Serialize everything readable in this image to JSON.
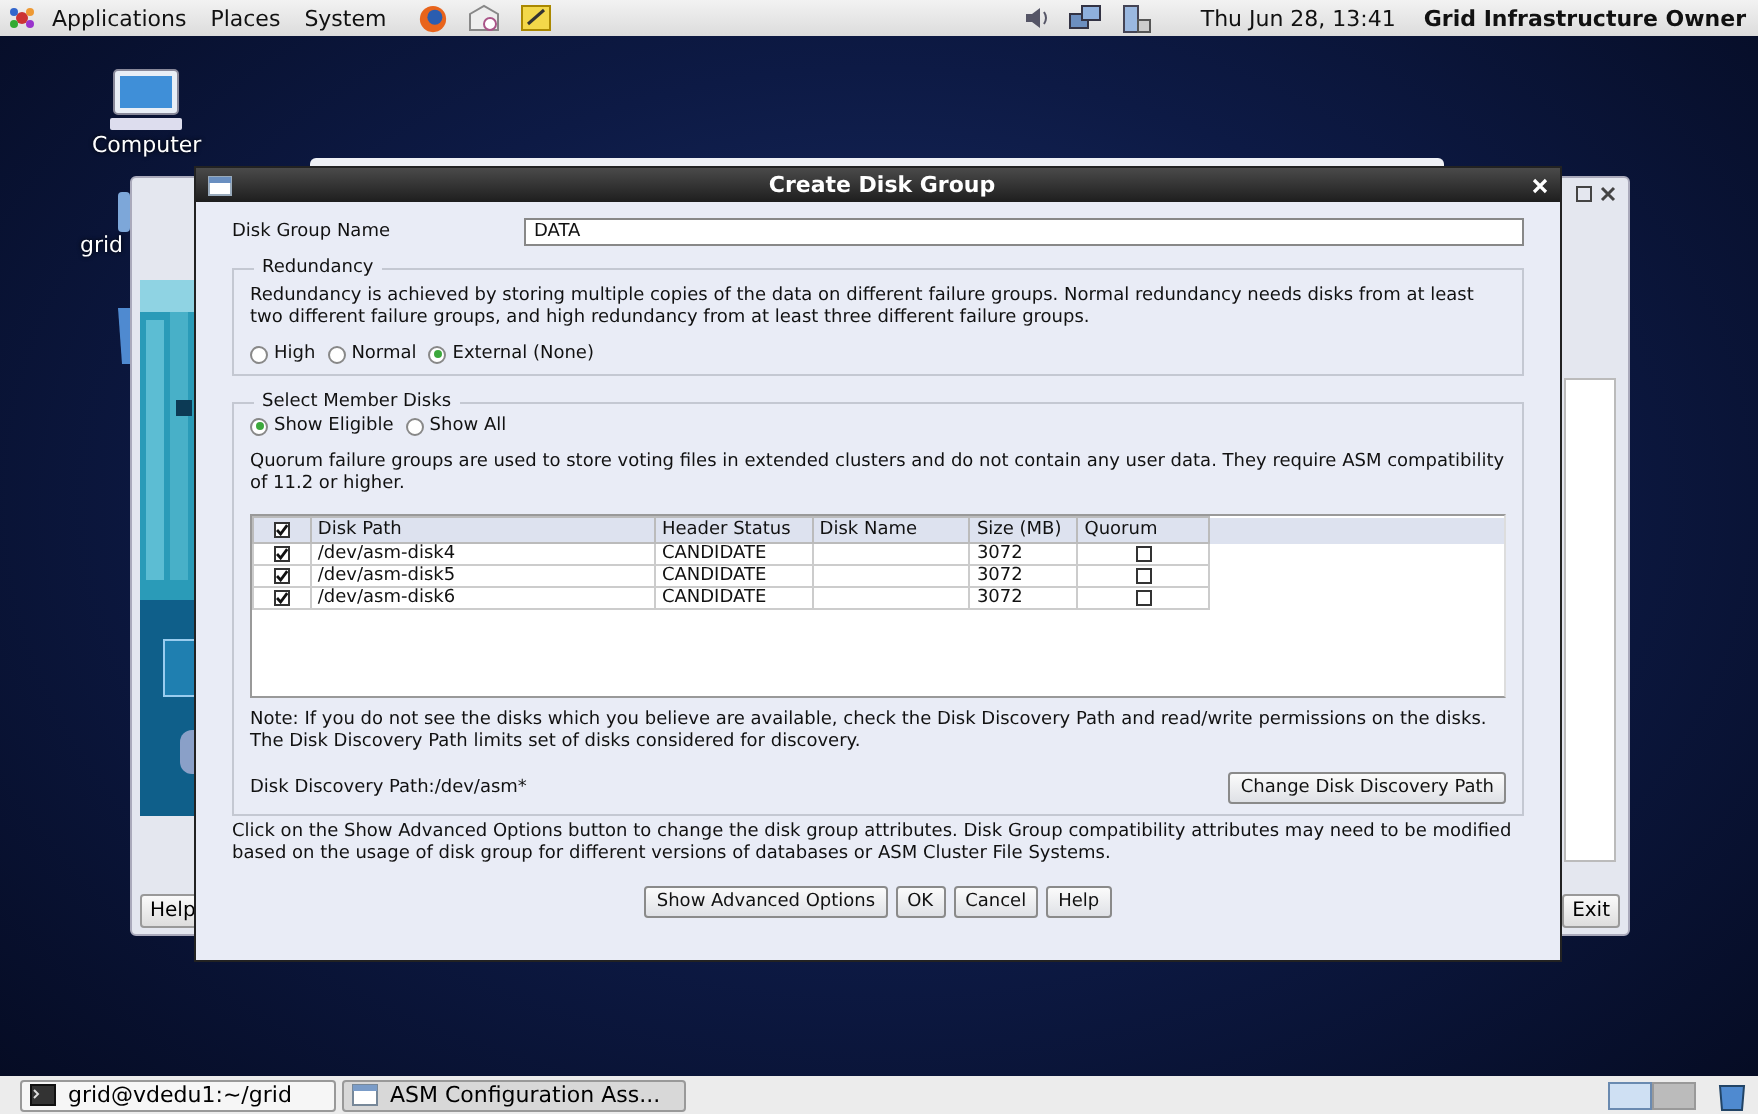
{
  "top_panel": {
    "menus": [
      "Applications",
      "Places",
      "System"
    ],
    "clock": "Thu Jun 28, 13:41",
    "user": "Grid Infrastructure Owner"
  },
  "desktop_icons": [
    {
      "label": "Computer"
    },
    {
      "label": "grid"
    }
  ],
  "background_window": {
    "buttons": [
      "Help",
      "Exit"
    ]
  },
  "dialog": {
    "title": "Create Disk Group",
    "disk_group_name": {
      "label": "Disk Group Name",
      "value": "DATA"
    },
    "redundancy": {
      "title": "Redundancy",
      "description": "Redundancy is achieved by storing multiple copies of the data on different failure groups. Normal redundancy needs disks from at least two different failure groups, and high redundancy from at least three different failure groups.",
      "options": [
        {
          "label": "High",
          "selected": false
        },
        {
          "label": "Normal",
          "selected": false
        },
        {
          "label": "External (None)",
          "selected": true
        }
      ]
    },
    "member_disks": {
      "title": "Select Member Disks",
      "filters": [
        {
          "label": "Show Eligible",
          "selected": true
        },
        {
          "label": "Show All",
          "selected": false
        }
      ],
      "quorum_note": "Quorum failure groups are used to store voting files in extended clusters and do not contain any user data. They require ASM compatibility of 11.2 or higher.",
      "table": {
        "all_checked": true,
        "columns": [
          "Disk Path",
          "Header Status",
          "Disk Name",
          "Size (MB)",
          "Quorum"
        ],
        "rows": [
          {
            "checked": true,
            "disk_path": "/dev/asm-disk4",
            "header_status": "CANDIDATE",
            "size": "3072",
            "quorum": false
          },
          {
            "checked": true,
            "disk_path": "/dev/asm-disk5",
            "header_status": "CANDIDATE",
            "size": "3072",
            "quorum": false
          },
          {
            "checked": true,
            "disk_path": "/dev/asm-disk6",
            "header_status": "CANDIDATE",
            "size": "3072",
            "quorum": false
          }
        ]
      },
      "discovery_note": "Note: If you do not see the disks which you believe are available, check the Disk Discovery Path and read/write permissions on the disks. The Disk Discovery Path limits set of disks considered for discovery.",
      "discovery_path": "Disk Discovery Path:/dev/asm*",
      "change_button": "Change Disk Discovery Path"
    },
    "advanced_note": "Click on the Show Advanced Options button to change the disk group attributes. Disk Group compatibility attributes may need to be modified based on the usage of disk group for different versions of databases or ASM Cluster File Systems.",
    "buttons": [
      "Show Advanced Options",
      "OK",
      "Cancel",
      "Help"
    ]
  },
  "taskbar": {
    "items": [
      {
        "label": "grid@vdedu1:~/grid",
        "kind": "terminal"
      },
      {
        "label": "ASM Configuration Ass...",
        "kind": "window"
      }
    ]
  }
}
